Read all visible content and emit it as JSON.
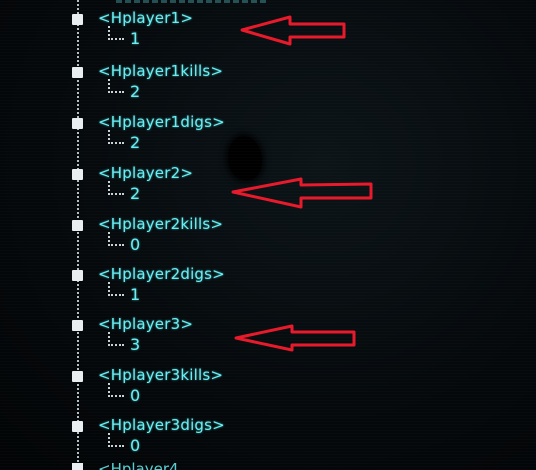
{
  "tree": {
    "partial_top_label": "",
    "nodes": [
      {
        "tag": "<Hplayer1>",
        "value": "1"
      },
      {
        "tag": "<Hplayer1kills>",
        "value": "2"
      },
      {
        "tag": "<Hplayer1digs>",
        "value": "2"
      },
      {
        "tag": "<Hplayer2>",
        "value": "2"
      },
      {
        "tag": "<Hplayer2kills>",
        "value": "0"
      },
      {
        "tag": "<Hplayer2digs>",
        "value": "1"
      },
      {
        "tag": "<Hplayer3>",
        "value": "3"
      },
      {
        "tag": "<Hplayer3kills>",
        "value": "0"
      },
      {
        "tag": "<Hplayer3digs>",
        "value": "0"
      }
    ],
    "partial_bottom_label": "<Hplayer4"
  },
  "annotations": {
    "arrow_color": "#e8192a",
    "arrows_point_to": [
      "<Hplayer1>",
      "<Hplayer2>",
      "<Hplayer3>"
    ]
  },
  "colors": {
    "text": "#66f0f4",
    "background": "#04070a",
    "tree_lines": "#c9d3d6"
  }
}
